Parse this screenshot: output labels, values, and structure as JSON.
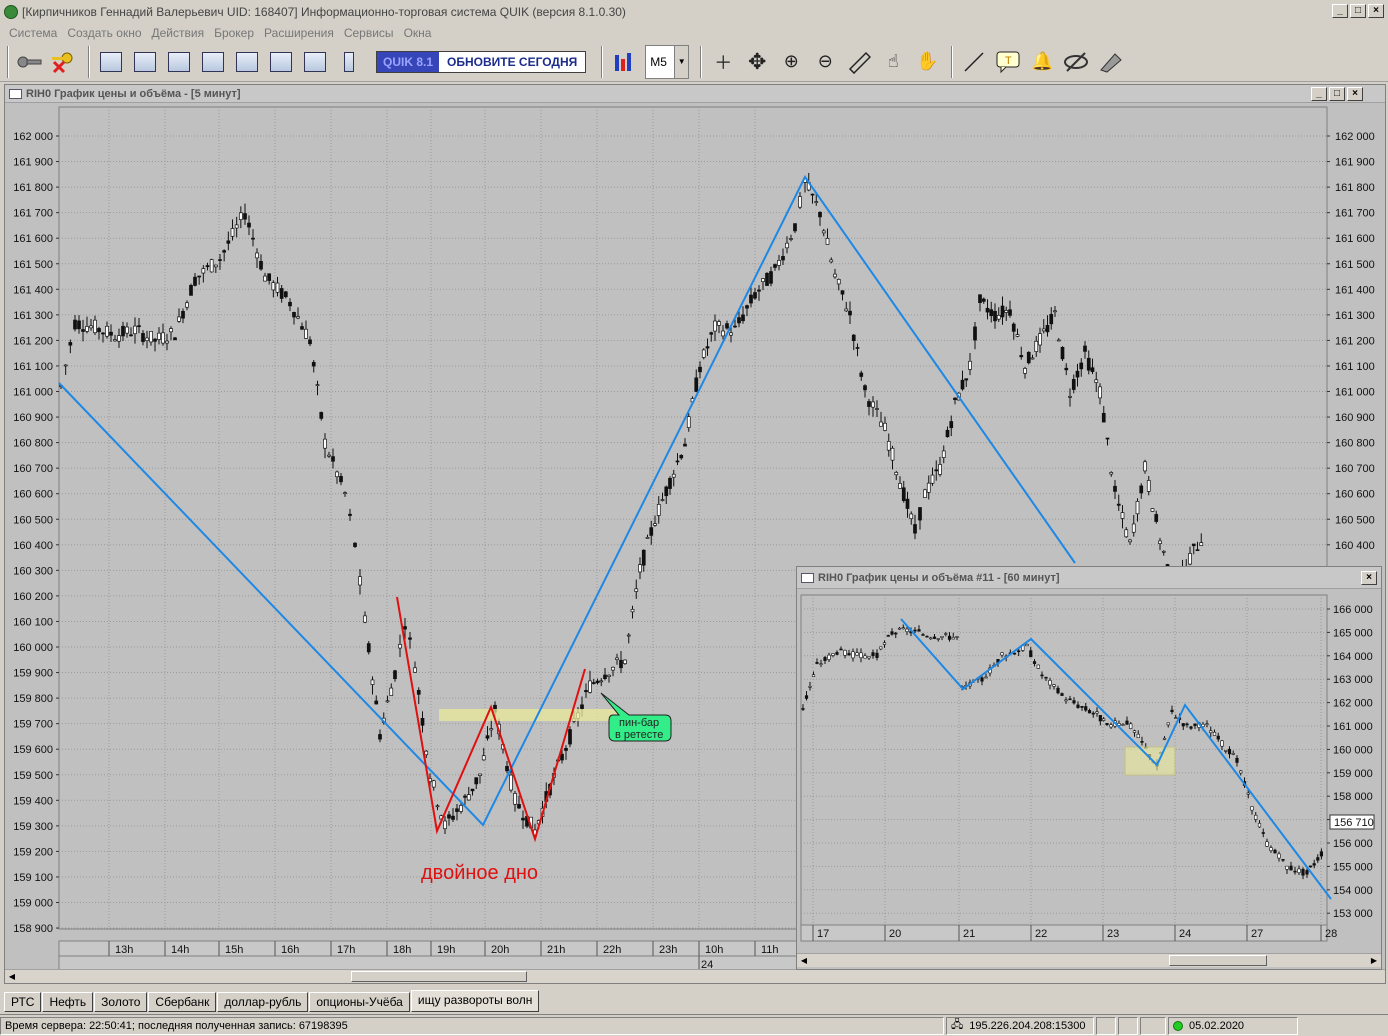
{
  "window": {
    "title": "[Кирпичников Геннадий Валерьевич UID: 168407] Информационно-торговая система QUIK (версия 8.1.0.30)"
  },
  "menu": [
    "Система",
    "Создать окно",
    "Действия",
    "Брокер",
    "Расширения",
    "Сервисы",
    "Окна"
  ],
  "toolbar": {
    "quik_version": "QUIK 8.1",
    "update_label": "ОБНОВИТЕ СЕГОДНЯ",
    "timeframe": "M5"
  },
  "main_chart": {
    "title": "RIH0 График цены и объёма - [5 минут]",
    "price_levels": [
      "162 000",
      "161 900",
      "161 800",
      "161 700",
      "161 600",
      "161 500",
      "161 400",
      "161 300",
      "161 200",
      "161 100",
      "161 000",
      "160 900",
      "160 800",
      "160 700",
      "160 600",
      "160 500",
      "160 400",
      "160 300",
      "160 200",
      "160 100",
      "160 000",
      "159 900",
      "159 800",
      "159 700",
      "159 600",
      "159 500",
      "159 400",
      "159 300",
      "159 200",
      "159 100",
      "159 000",
      "158 900"
    ],
    "time_labels": [
      "13h",
      "14h",
      "15h",
      "16h",
      "17h",
      "18h",
      "19h",
      "20h",
      "21h",
      "22h",
      "23h",
      "10h",
      "11h"
    ],
    "date_label": "24",
    "annotation_pattern": "двойное дно",
    "annotation_callout": [
      "пин-бар",
      "в ретесте"
    ]
  },
  "mini_chart": {
    "title": "RIH0 График цены и объёма #11 - [60 минут]",
    "price_levels": [
      "166 000",
      "165 000",
      "164 000",
      "163 000",
      "162 000",
      "161 000",
      "160 000",
      "159 000",
      "158 000",
      "157 000",
      "156 000",
      "155 000",
      "154 000",
      "153 000"
    ],
    "current_price": "156 710",
    "date_labels": [
      "17",
      "20",
      "21",
      "22",
      "23",
      "24",
      "27",
      "28"
    ]
  },
  "tabs": [
    "РТС",
    "Нефть",
    "Золото",
    "Сбербанк",
    "доллар-рубль",
    "опционы-Учёба",
    "ищу развороты волн"
  ],
  "active_tab": "ищу развороты волн",
  "status": {
    "server_time": "Время сервера: 22:50:41; последняя полученная запись: 67198395",
    "server_addr": "195.226.204.208:15300",
    "date": "05.02.2020"
  },
  "colors": {
    "bg": "#d4d0c8",
    "plot_bg": "#c0c0c0",
    "grid": "#9a9a9a",
    "trend_line": "#1e88e5",
    "zigzag": "#e01010",
    "zone": "#eaea9a",
    "callout": "#33ee88"
  }
}
